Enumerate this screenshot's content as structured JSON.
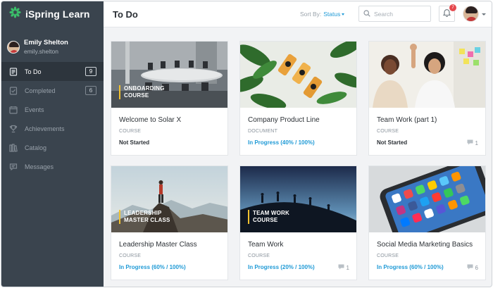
{
  "app": {
    "name": "iSpring Learn"
  },
  "user": {
    "name": "Emily Shelton",
    "login": "emily.shelton"
  },
  "sidebar": {
    "items": [
      {
        "label": "To Do",
        "count": "9",
        "icon": "todo-icon",
        "active": true
      },
      {
        "label": "Completed",
        "count": "6",
        "icon": "completed-icon"
      },
      {
        "label": "Events",
        "icon": "calendar-icon"
      },
      {
        "label": "Achievements",
        "icon": "trophy-icon"
      },
      {
        "label": "Catalog",
        "icon": "catalog-icon"
      },
      {
        "label": "Messages",
        "icon": "messages-icon"
      }
    ]
  },
  "header": {
    "title": "To Do",
    "sort_label": "Sort By:",
    "sort_value": "Status",
    "search_placeholder": "Search",
    "notifications_count": "7"
  },
  "cards": [
    {
      "title": "Welcome to Solar X",
      "type": "COURSE",
      "status": "Not Started",
      "thumb_label": "ONBOARDING COURSE"
    },
    {
      "title": "Company Product Line",
      "type": "DOCUMENT",
      "status": "In Progress (40% / 100%)"
    },
    {
      "title": "Team Work (part 1)",
      "type": "COURSE",
      "status": "Not Started",
      "comments": "1"
    },
    {
      "title": "Leadership Master Class",
      "type": "COURSE",
      "status": "In Progress (60% / 100%)",
      "thumb_label": "LEADERSHIP MASTER CLASS"
    },
    {
      "title": "Team Work",
      "type": "COURSE",
      "status": "In Progress (20% / 100%)",
      "thumb_label": "TEAM WORK COURSE",
      "comments": "1"
    },
    {
      "title": "Social Media Marketing Basics",
      "type": "COURSE",
      "status": "In Progress (60% / 100%)",
      "comments": "6"
    }
  ],
  "colors": {
    "sidebar": "#3a444e",
    "accent": "#1f9ad6",
    "label_bar": "#f2c230",
    "badge": "#e5484d"
  }
}
